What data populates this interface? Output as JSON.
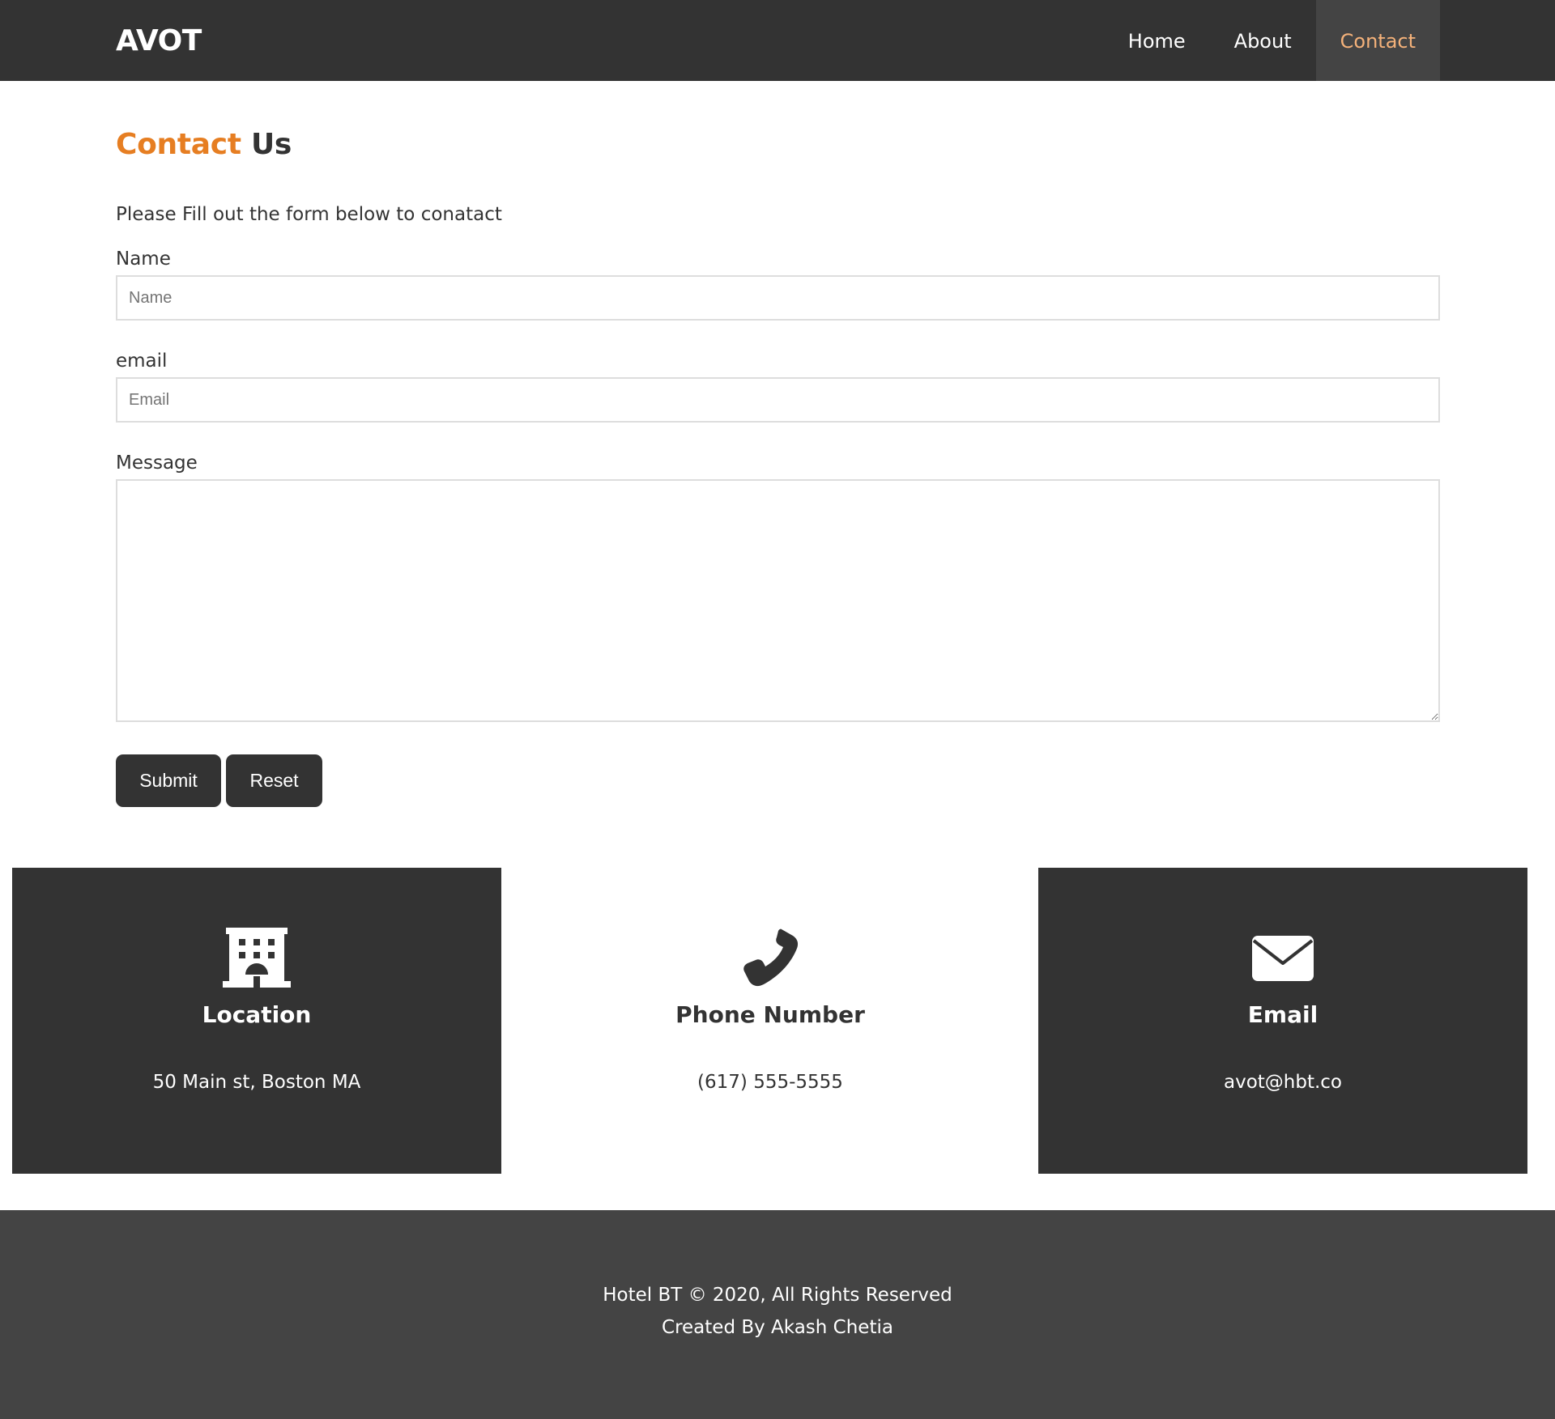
{
  "header": {
    "brand": "AVOT",
    "nav": [
      {
        "label": "Home"
      },
      {
        "label": "About"
      },
      {
        "label": "Contact",
        "active": true
      }
    ]
  },
  "contact": {
    "heading_accent": "Contact",
    "heading_rest": "Us",
    "intro": "Please Fill out the form below to conatact",
    "name": {
      "label": "Name",
      "placeholder": "Name",
      "value": ""
    },
    "email": {
      "label": "email",
      "placeholder": "Email",
      "value": ""
    },
    "message": {
      "label": "Message",
      "value": ""
    },
    "submit_label": "Submit",
    "reset_label": "Reset"
  },
  "cards": [
    {
      "icon": "building-icon",
      "title": "Location",
      "value": "50 Main st, Boston MA"
    },
    {
      "icon": "phone-icon",
      "title": "Phone Number",
      "value": "(617) 555-5555"
    },
    {
      "icon": "envelope-icon",
      "title": "Email",
      "value": "avot@hbt.co"
    }
  ],
  "footer": {
    "line1": "Hotel BT © 2020, All Rights Reserved",
    "line2": "Created By Akash Chetia"
  },
  "colors": {
    "nav_bg": "#333333",
    "accent": "#e67e22",
    "active_nav_text": "#f5b27a",
    "footer_bg": "#444444"
  }
}
